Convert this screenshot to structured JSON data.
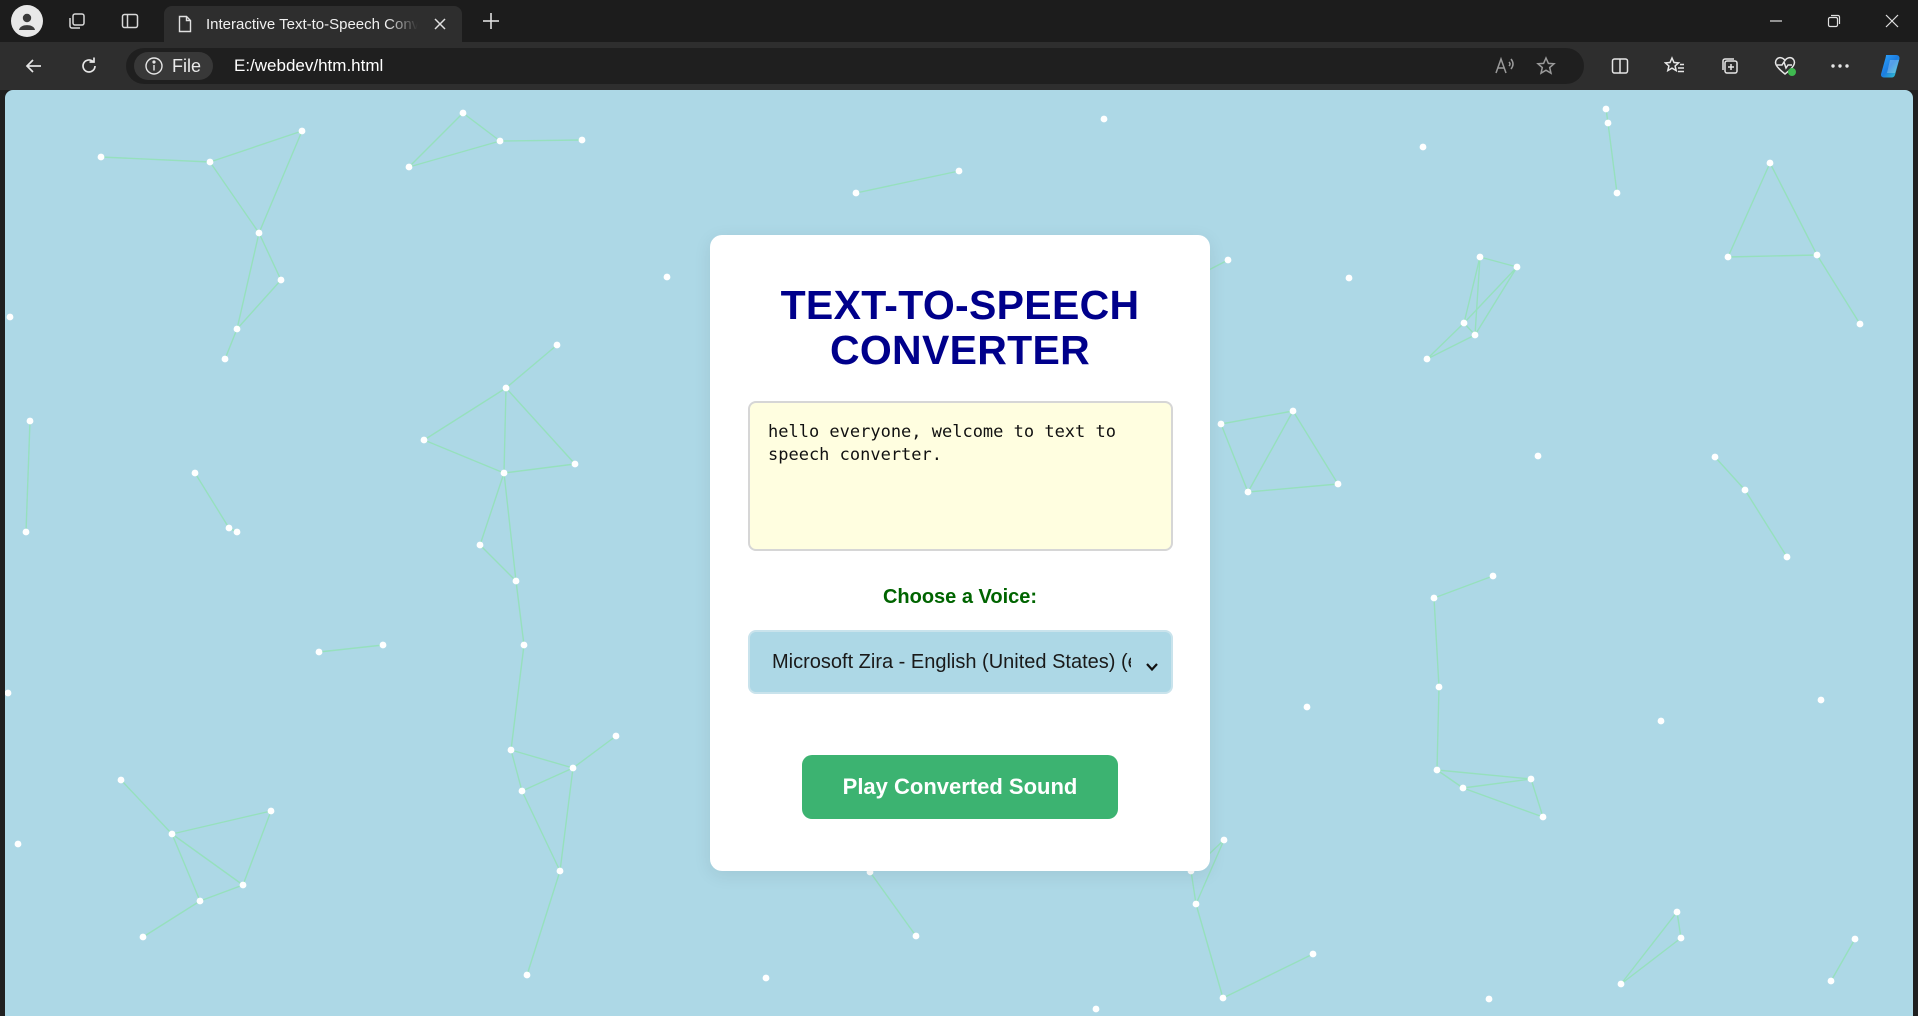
{
  "browser": {
    "tab_title": "Interactive Text-to-Speech Converter",
    "address_label": "File",
    "url": "E:/webdev/htm.html"
  },
  "page": {
    "title": "TEXT-TO-SPEECH CONVERTER",
    "text_input_value": "hello everyone, welcome to text to speech converter.",
    "voice_label": "Choose a Voice:",
    "voice_selected": "Microsoft Zira - English (United States) (en-US)",
    "play_button": "Play Converted Sound"
  },
  "colors": {
    "background": "#add8e6",
    "title": "#00008b",
    "voice_label": "#006400",
    "button": "#3cb371",
    "textarea_bg": "#fffee0",
    "network_dots": "#ffffff",
    "network_lines": "#8fe3b0"
  },
  "icons": {
    "profile": "profile-icon",
    "workspaces": "workspaces-icon",
    "tab_actions": "tab-actions-icon",
    "page": "page-icon",
    "close_tab": "close-icon",
    "new_tab": "plus-icon",
    "minimize": "minimize-icon",
    "restore": "restore-icon",
    "close_window": "close-icon",
    "back": "back-arrow-icon",
    "refresh": "refresh-icon",
    "info": "info-icon",
    "read_aloud": "read-aloud-icon",
    "favorite": "star-icon",
    "split_screen": "split-screen-icon",
    "favorites": "favorites-icon",
    "collections": "collections-icon",
    "browser_essentials": "heartbeat-icon",
    "more": "more-icon",
    "copilot": "copilot-icon",
    "select_chevron": "chevron-down-icon"
  }
}
